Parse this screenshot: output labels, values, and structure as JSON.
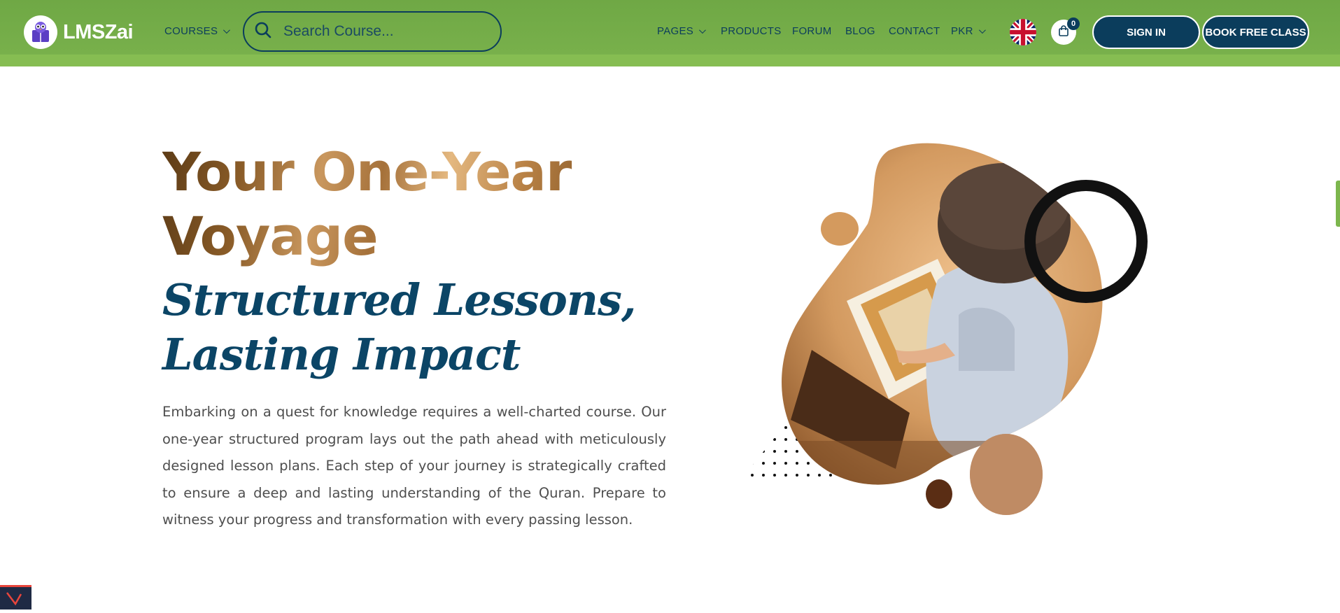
{
  "brand": {
    "name": "LMSZai",
    "logo_icon": "book-owl-icon"
  },
  "nav": {
    "courses": "COURSES",
    "search_placeholder": "Search Course...",
    "pages": "PAGES",
    "products": "PRODUCTS",
    "forum": "FORUM",
    "blog": "BLOG",
    "contact": "CONTACT",
    "currency": "PKR",
    "language_flag": "uk-flag-icon",
    "cart_count": "0",
    "sign_in": "SIGN IN",
    "book_free_class": "BOOK FREE CLASS"
  },
  "hero": {
    "title": "Your One-Year Voyage",
    "script_title": "Structured Lessons, Lasting Impact",
    "description": "Embarking on a quest for knowledge requires a well-charted course. Our one-year structured program lays out the path ahead with meticulously designed lesson plans. Each step of your journey is strategically crafted to ensure a deep and lasting understanding of the Quran. Prepare to witness your progress and transformation with every passing lesson."
  },
  "colors": {
    "header_green": "#78b04b",
    "navy": "#0b3d5c",
    "accent_brown": "#d49a5e"
  }
}
